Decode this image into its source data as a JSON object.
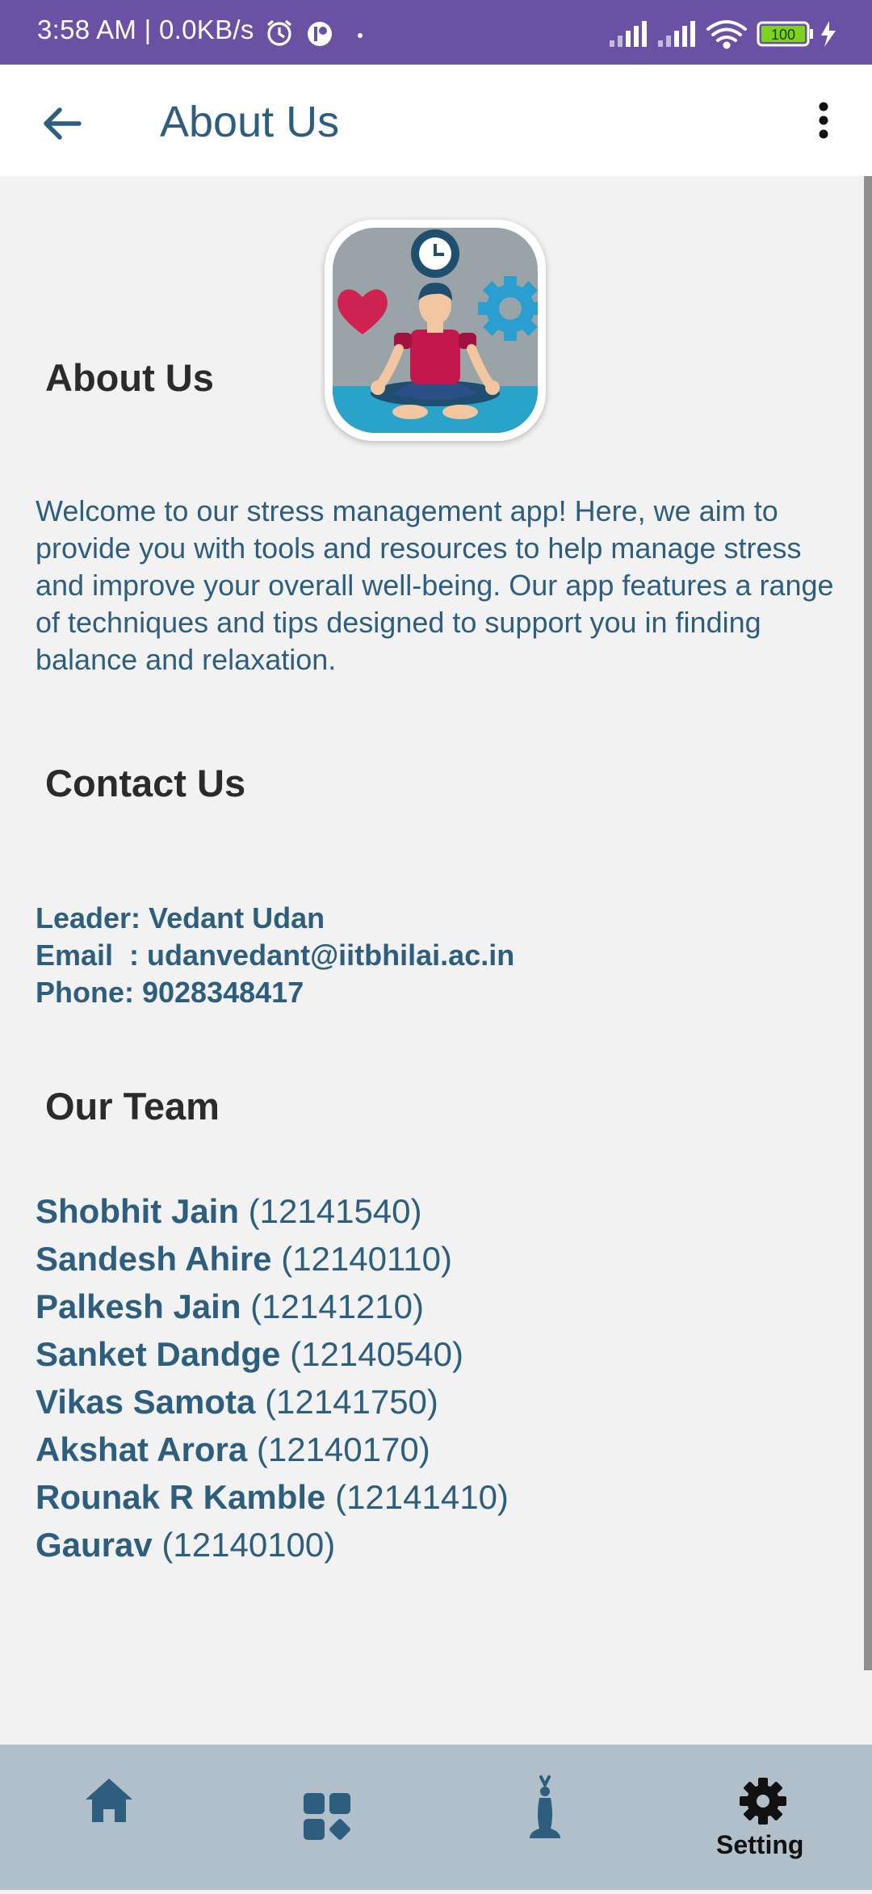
{
  "status_bar": {
    "time": "3:58 AM | 0.0KB/s",
    "battery": "100",
    "icons": [
      "alarm-icon",
      "app-notification-icon",
      "dot-icon",
      "signal-icon",
      "signal-icon",
      "wifi-icon",
      "battery-icon",
      "charging-icon"
    ]
  },
  "app_bar": {
    "title": "About Us",
    "back_icon": "arrow-back-icon",
    "menu_icon": "more-vert-icon"
  },
  "about": {
    "heading": "About Us",
    "text": "Welcome to our stress management app! Here, we aim to provide you with tools and resources to help manage stress and improve your overall well-being. Our app features a range of techniques and tips designed to support you in finding balance and relaxation."
  },
  "contact": {
    "heading": "Contact Us",
    "leader": "Leader: Vedant Udan",
    "email": "Email  : udanvedant@iitbhilai.ac.in",
    "phone": "Phone: 9028348417"
  },
  "team": {
    "heading": "Our Team",
    "members": [
      {
        "name": "Shobhit Jain",
        "id": "(12141540)"
      },
      {
        "name": "Sandesh Ahire",
        "id": "(12140110)"
      },
      {
        "name": "Palkesh Jain",
        "id": "(12141210)"
      },
      {
        "name": "Sanket Dandge",
        "id": "(12140540)"
      },
      {
        "name": "Vikas Samota",
        "id": "(12141750)"
      },
      {
        "name": "Akshat Arora",
        "id": "(12140170)"
      },
      {
        "name": "Rounak R Kamble",
        "id": "(12141410)"
      },
      {
        "name": "Gaurav",
        "id": "(12140100)"
      }
    ]
  },
  "bottom_nav": {
    "items": [
      {
        "icon": "home-icon"
      },
      {
        "icon": "dashboard-icon"
      },
      {
        "icon": "meditation-icon"
      },
      {
        "icon": "gear-icon",
        "label": "Setting"
      }
    ]
  },
  "colors": {
    "status_bar": "#6a51a3",
    "accent_text": "#2e5e7e",
    "heading_text": "#2b2b2b",
    "background": "#f2f2f2",
    "bottom_nav": "#b0bfc9",
    "battery_green": "#7ed321"
  }
}
